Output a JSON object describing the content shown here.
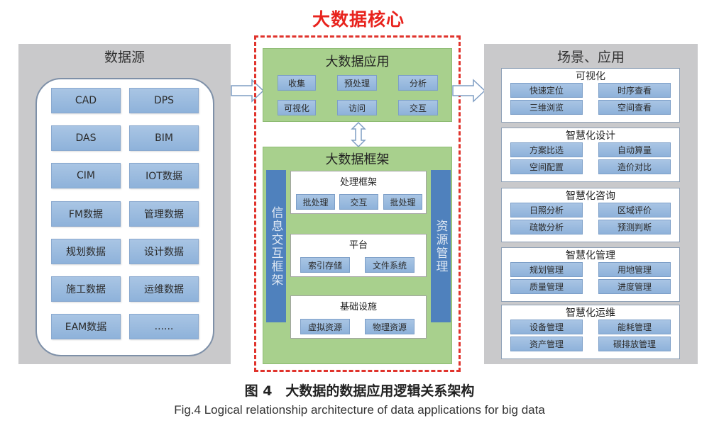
{
  "data_source": {
    "title": "数据源",
    "items": [
      "CAD",
      "DPS",
      "DAS",
      "BIM",
      "CIM",
      "IOT数据",
      "FM数据",
      "管理数据",
      "规划数据",
      "设计数据",
      "施工数据",
      "运维数据",
      "EAM数据",
      "......"
    ]
  },
  "core": {
    "title": "大数据核心",
    "application": {
      "title": "大数据应用",
      "items": [
        "收集",
        "预处理",
        "分析",
        "可视化",
        "访问",
        "交互"
      ]
    },
    "framework": {
      "title": "大数据框架",
      "left_bar": "信息交互框架",
      "right_bar": "资源管理",
      "processing": {
        "title": "处理框架",
        "items": [
          "批处理",
          "交互",
          "批处理"
        ]
      },
      "platform": {
        "title": "平台",
        "items": [
          "索引存储",
          "文件系统"
        ]
      },
      "infrastructure": {
        "title": "基础设施",
        "items": [
          "虚拟资源",
          "物理资源"
        ]
      }
    }
  },
  "scenarios": {
    "title": "场景、应用",
    "groups": [
      {
        "title": "可视化",
        "items": [
          "快速定位",
          "时序查看",
          "三维浏览",
          "空间查看"
        ]
      },
      {
        "title": "智慧化设计",
        "items": [
          "方案比选",
          "自动算量",
          "空间配置",
          "造价对比"
        ]
      },
      {
        "title": "智慧化咨询",
        "items": [
          "日照分析",
          "区域评价",
          "疏散分析",
          "预测判断"
        ]
      },
      {
        "title": "智慧化管理",
        "items": [
          "规划管理",
          "用地管理",
          "质量管理",
          "进度管理"
        ]
      },
      {
        "title": "智慧化运维",
        "items": [
          "设备管理",
          "能耗管理",
          "资产管理",
          "碳排放管理"
        ]
      }
    ]
  },
  "caption": {
    "cn": "图 4　大数据的数据应用逻辑关系架构",
    "en": "Fig.4  Logical relationship architecture of data applications for big data"
  },
  "colors": {
    "core_border": "#e0332c",
    "core_title": "#e8231d",
    "green_panel": "#a8d08d",
    "blue_bar": "#4f81bd",
    "button_blue": "#9dbde0",
    "gray_panel": "#c9c9cb"
  }
}
